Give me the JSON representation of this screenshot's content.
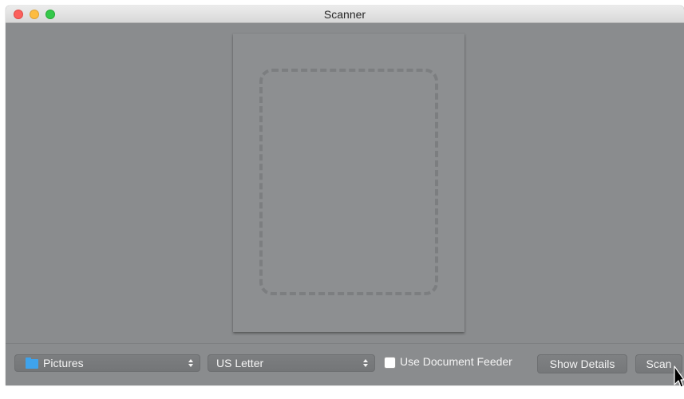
{
  "window": {
    "title": "Scanner"
  },
  "toolbar": {
    "folder_popup": {
      "selected": "Pictures",
      "icon": "folder-icon"
    },
    "size_popup": {
      "selected": "US Letter"
    },
    "document_feeder": {
      "label": "Use Document Feeder",
      "checked": false
    },
    "show_details_label": "Show Details",
    "scan_label": "Scan"
  },
  "colors": {
    "window_background": "#8a8c8e",
    "folder_icon": "#3fa3ec",
    "close_light": "#fc605c",
    "minimize_light": "#fdbc40",
    "maximize_light": "#34c84a"
  }
}
